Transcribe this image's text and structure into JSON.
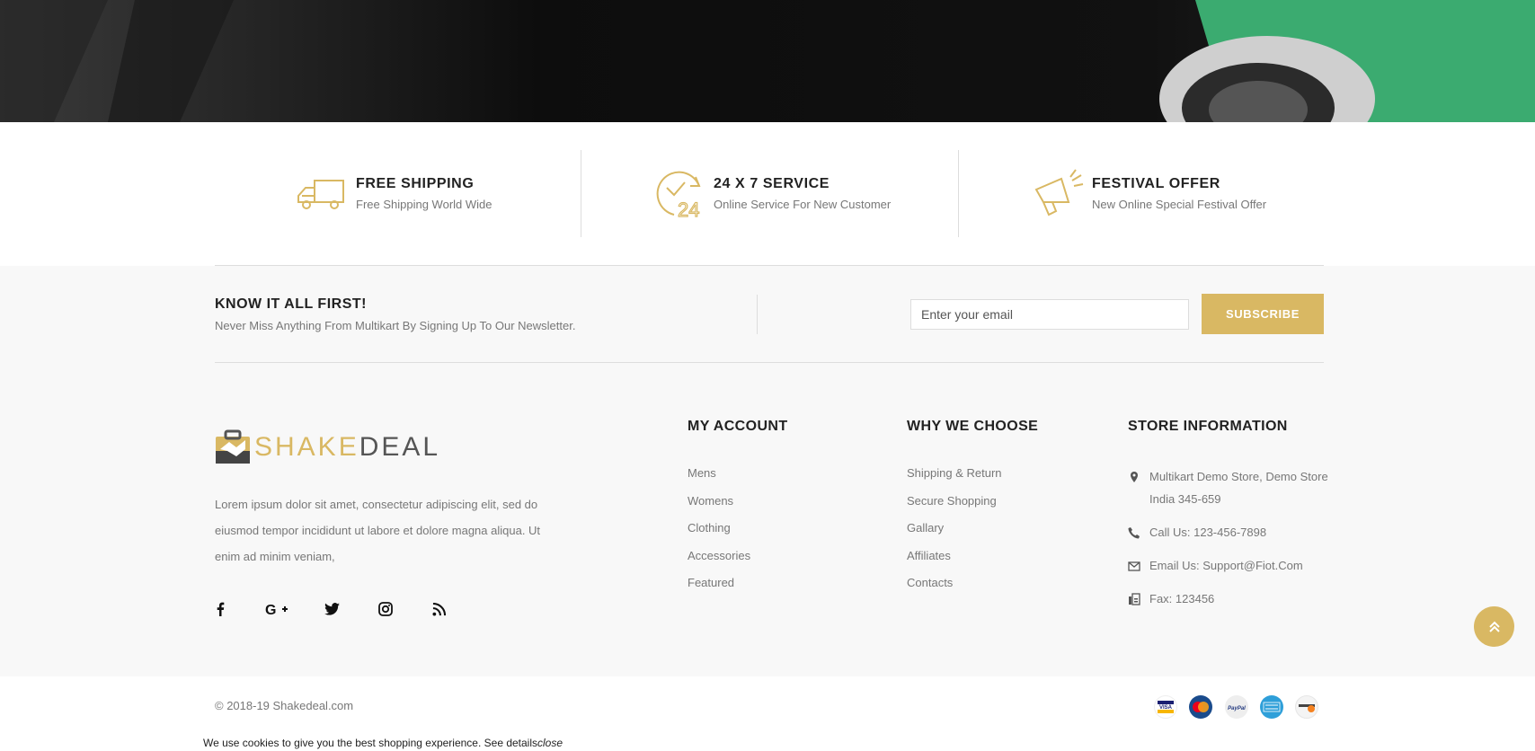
{
  "services": [
    {
      "title": "FREE SHIPPING",
      "subtitle": "Free Shipping World Wide",
      "icon": "truck-icon"
    },
    {
      "title": "24 X 7 SERVICE",
      "subtitle": "Online Service For New Customer",
      "icon": "clock-24-icon"
    },
    {
      "title": "FESTIVAL OFFER",
      "subtitle": "New Online Special Festival Offer",
      "icon": "megaphone-icon"
    }
  ],
  "newsletter": {
    "title": "KNOW IT ALL FIRST!",
    "subtitle": "Never Miss Anything From Multikart By Signing Up To Our Newsletter.",
    "placeholder": "Enter your email",
    "button": "SUBSCRIBE"
  },
  "brand": {
    "logo_part1": "SHAKE",
    "logo_part2": "DEAL",
    "about": "Lorem ipsum dolor sit amet, consectetur adipiscing elit, sed do eiusmod tempor incididunt ut labore et dolore magna aliqua. Ut enim ad minim veniam,",
    "social": [
      "facebook-icon",
      "google-plus-icon",
      "twitter-icon",
      "instagram-icon",
      "rss-icon"
    ]
  },
  "my_account": {
    "title": "MY ACCOUNT",
    "links": [
      "Mens",
      "Womens",
      "Clothing",
      "Accessories",
      "Featured"
    ]
  },
  "why_choose": {
    "title": "WHY WE CHOOSE",
    "links": [
      "Shipping & Return",
      "Secure Shopping",
      "Gallary",
      "Affiliates",
      "Contacts"
    ]
  },
  "store": {
    "title": "STORE INFORMATION",
    "address_line1": "Multikart Demo Store, Demo Store",
    "address_line2": "India 345-659",
    "phone": "Call Us: 123-456-7898",
    "email": "Email Us: Support@Fiot.Com",
    "fax": "Fax: 123456"
  },
  "bottom": {
    "copyright": "© 2018-19 Shakedeal.com",
    "payments": [
      {
        "name": "VISA",
        "color": "#1a1f71"
      },
      {
        "name": "MasterCard",
        "color": "#1a4b8c"
      },
      {
        "name": "PayPal",
        "color": "#e9e9e9"
      },
      {
        "name": "AMERICAN EXPRESS",
        "color": "#2e9fd9"
      },
      {
        "name": "DISCOVER",
        "color": "#f1f1f1"
      }
    ]
  },
  "cookie": {
    "text": "We use cookies to give you the best shopping experience. ",
    "details": "See details",
    "close": "close"
  },
  "colors": {
    "accent": "#d9b863",
    "text_dark": "#222222",
    "text_muted": "#777777",
    "footer_bg": "#f8f8f8"
  }
}
